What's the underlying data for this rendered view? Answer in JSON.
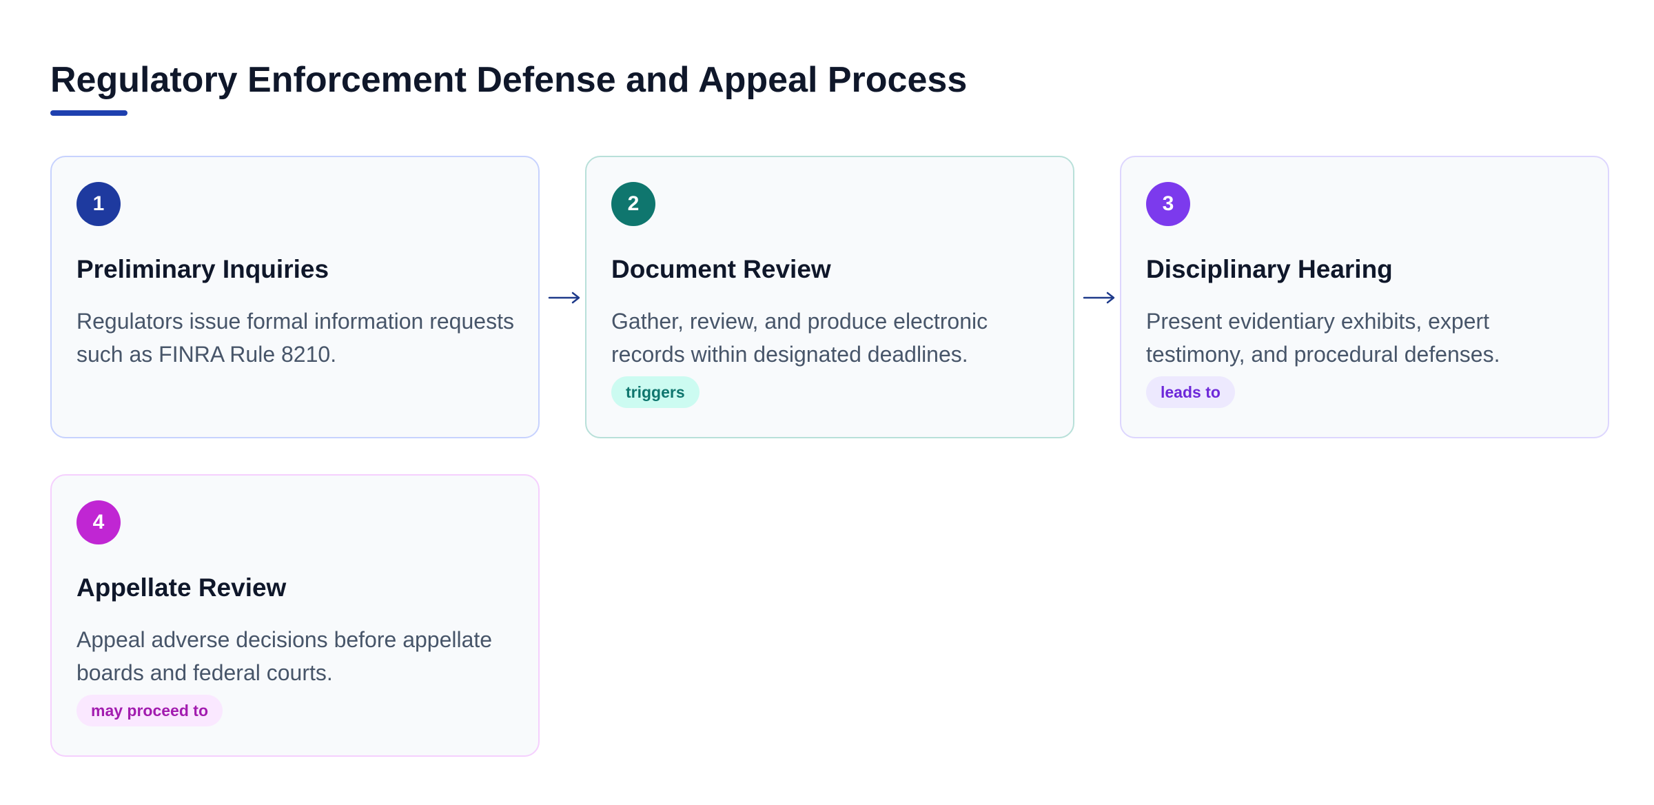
{
  "diagram": {
    "title": "Regulatory Enforcement Defense and Appeal Process",
    "colors": {
      "title": "#0f172a",
      "underline": "#1e40af",
      "arrow": "#1e3a8a",
      "step1": "#1e3a9f",
      "step2": "#0f766e",
      "step3": "#7c3aed",
      "step4": "#c026d3"
    },
    "steps": [
      {
        "number": "1",
        "title": "Preliminary Inquiries",
        "description": "Regulators issue formal information requests such as FINRA Rule 8210."
      },
      {
        "number": "2",
        "title": "Document Review",
        "description": "Gather, review, and produce electronic records within designated deadlines.",
        "tag": "triggers"
      },
      {
        "number": "3",
        "title": "Disciplinary Hearing",
        "description": "Present evidentiary exhibits, expert testimony, and procedural defenses.",
        "tag": "leads to"
      },
      {
        "number": "4",
        "title": "Appellate Review",
        "description": "Appeal adverse decisions before appellate boards and federal courts.",
        "tag": "may proceed to"
      }
    ],
    "connectors": [
      {
        "from": "1",
        "to": "2",
        "icon": "right-arrow-icon"
      },
      {
        "from": "2",
        "to": "3",
        "icon": "right-arrow-icon"
      }
    ]
  }
}
